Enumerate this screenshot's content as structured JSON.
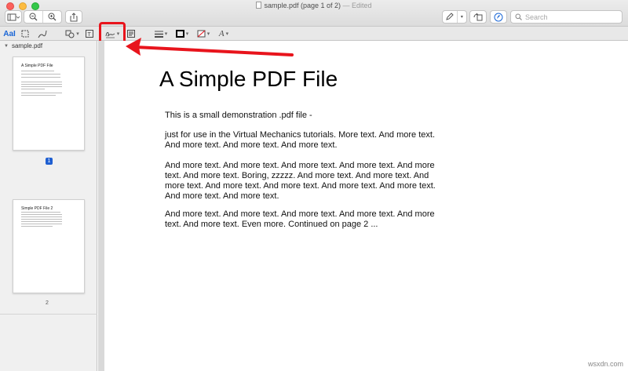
{
  "window": {
    "title": "sample.pdf (page 1 of 2)",
    "title_separator": " — ",
    "title_status": "Edited"
  },
  "toolbar": {
    "search_placeholder": "Search",
    "icons": [
      "sidebar-icon",
      "zoom-out-icon",
      "zoom-in-icon",
      "share-icon",
      "pen-icon",
      "rotate-icon",
      "markup-icon",
      "search-icon"
    ]
  },
  "markup": {
    "text_tool_label": "AaI",
    "tools": [
      "text-selection",
      "rectangular-selection",
      "sketch",
      "shapes",
      "text",
      "sign",
      "note",
      "shape-style",
      "border-color",
      "fill-color",
      "text-style"
    ]
  },
  "sidebar": {
    "file_label": "sample.pdf",
    "pages": [
      {
        "number": "1",
        "thumb_title": "A Simple PDF File",
        "selected": true
      },
      {
        "number": "2",
        "thumb_title": "Simple PDF File 2",
        "selected": false
      }
    ]
  },
  "document": {
    "title": "A Simple PDF File",
    "paragraphs": [
      "This is a small demonstration .pdf file -",
      "just for use in the Virtual Mechanics tutorials. More text. And more text. And more text. And more text. And more text.",
      "And more text. And more text. And more text. And more text. And more text. And more text. Boring, zzzzz. And more text. And more text. And more text. And more text. And more text. And more text. And more text. And more text. And more text.",
      "And more text. And more text. And more text. And more text. And more text. And more text. Even more. Continued on page 2 ..."
    ]
  },
  "annotation": {
    "highlight_color": "#e8141c"
  },
  "watermark": "wsxdn.com"
}
